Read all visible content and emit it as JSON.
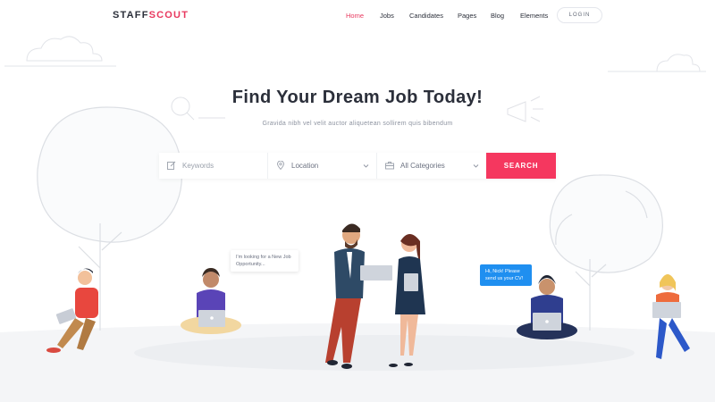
{
  "nav": {
    "logo_part1": "STAFF",
    "logo_part2": "SCOUT",
    "items": [
      {
        "label": "Home",
        "active": true
      },
      {
        "label": "Jobs",
        "active": false
      },
      {
        "label": "Candidates",
        "active": false
      },
      {
        "label": "Pages",
        "active": false
      },
      {
        "label": "Blog",
        "active": false
      },
      {
        "label": "Elements",
        "active": false
      }
    ],
    "login_label": "LOGIN"
  },
  "hero": {
    "title": "Find Your Dream Job Today!",
    "subtitle": "Gravida nibh vel velit auctor aliquetean sollirem quis bibendum"
  },
  "search": {
    "keywords_placeholder": "Keywords",
    "location_value": "Location",
    "category_value": "All Categories",
    "button_label": "SEARCH"
  },
  "bubbles": {
    "left": "I'm looking for a New Job Opportunity...",
    "right": "Hi, Nick! Please send us your CV!"
  },
  "colors": {
    "accent": "#f5375f",
    "chat_blue": "#1f8ff0",
    "text_dark": "#2b2f3a"
  }
}
